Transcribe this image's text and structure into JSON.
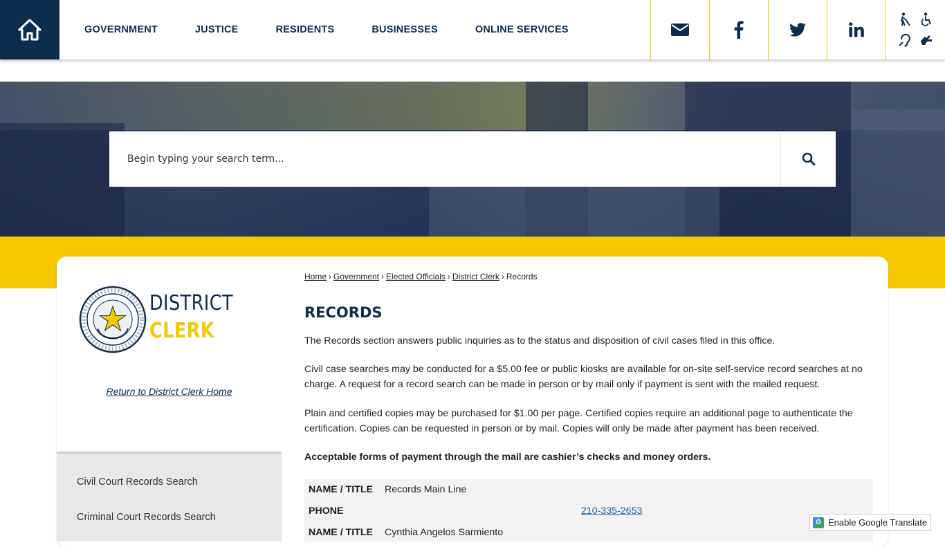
{
  "header": {
    "nav": [
      "GOVERNMENT",
      "JUSTICE",
      "RESIDENTS",
      "BUSINESSES",
      "ONLINE SERVICES"
    ],
    "social": [
      "email-icon",
      "facebook-icon",
      "twitter-icon",
      "linkedin-icon"
    ],
    "accessibility_icons": [
      "blind-icon",
      "wheelchair-icon",
      "hearing-icon",
      "sign-language-icon"
    ],
    "colors": {
      "navy": "#0d2d4f",
      "gold": "#f5c800"
    }
  },
  "search": {
    "placeholder": "Begin typing your search term..."
  },
  "sidebar": {
    "logo_line1": "DISTRICT",
    "logo_line2": "CLERK",
    "seal_text": "THE STATE OF TEXAS · COUNTY OF BEXAR",
    "return_link": "Return to District Clerk Home",
    "items": [
      "Civil Court Records Search",
      "Criminal Court Records Search"
    ]
  },
  "breadcrumb": {
    "links": [
      "Home",
      "Government",
      "Elected Officials",
      "District Clerk"
    ],
    "current": "Records"
  },
  "main": {
    "title": "RECORDS",
    "p1": "The Records section answers public inquiries as to the status and disposition of civil cases filed in this office.",
    "p2": "Civil case searches may be conducted for a $5.00 fee or public kiosks are available for on-site self-service record searches at no charge. A request for a record search can be made in person or by mail only if payment is sent with the mailed request.",
    "p3": "Plain and certified copies may be purchased for $1.00 per page. Certified copies require an additional page to authenticate the certification. Copies can be requested in person or by mail. Copies will only be made after payment has been received.",
    "p4": "Acceptable forms of payment through the mail are cashier’s checks and money orders."
  },
  "contact": {
    "name_label": "NAME / TITLE",
    "name_value": "Records Main Line",
    "phone_label": "PHONE",
    "phone_value": "210-335-2653",
    "name_label_2": "NAME / TITLE",
    "name_value_2": "Cynthia Angelos Sarmiento"
  },
  "translate": {
    "label": "Enable Google Translate"
  }
}
